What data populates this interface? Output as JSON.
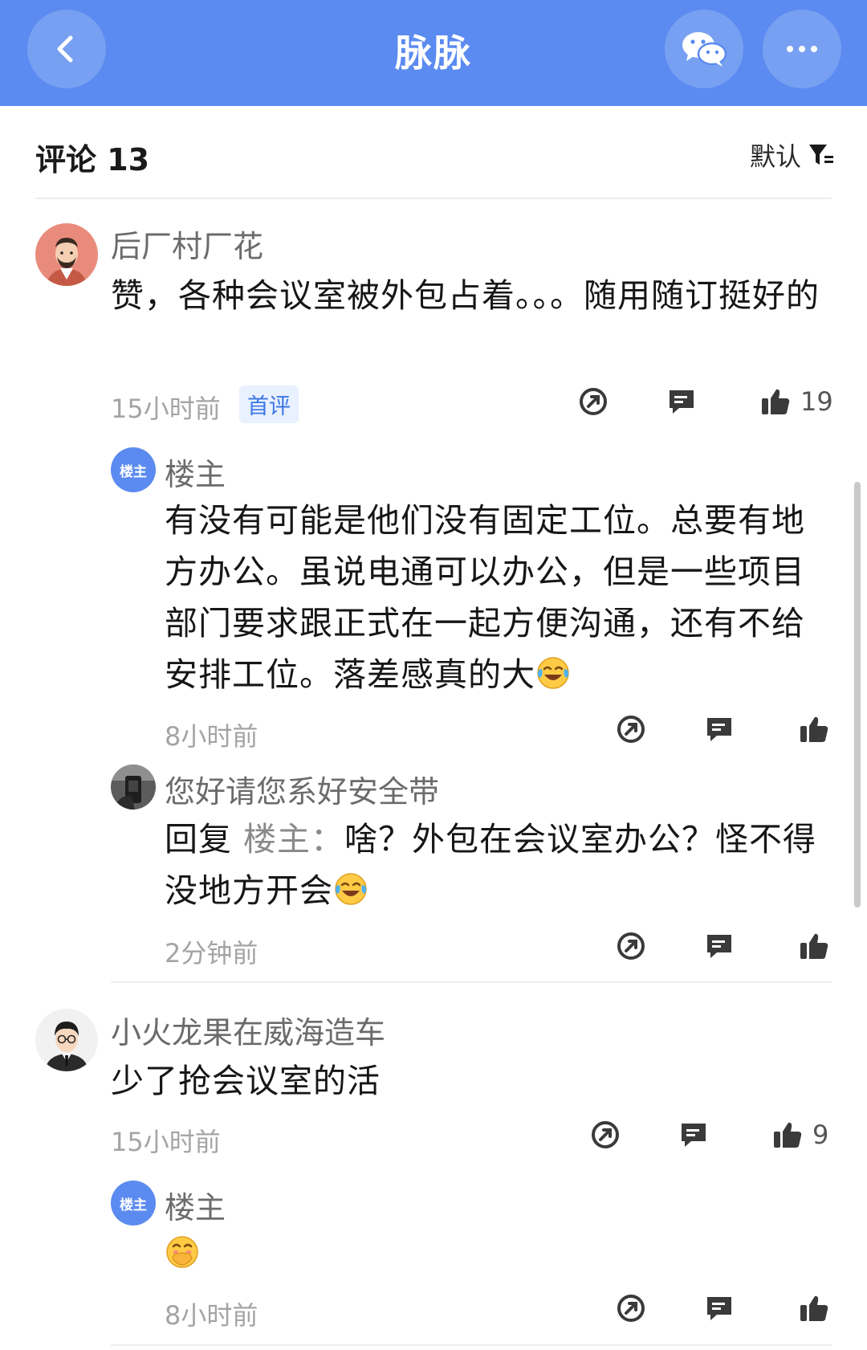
{
  "header": {
    "title": "脉脉"
  },
  "comments_header": {
    "label": "评论 13",
    "sort_label": "默认"
  },
  "threads": [
    {
      "user": "后厂村厂花",
      "text": "赞，各种会议室被外包占着。。。随用随订挺好的",
      "time": "15小时前",
      "tag": "首评",
      "likes": "19",
      "replies": [
        {
          "user": "楼主",
          "badge": "楼主",
          "text": "有没有可能是他们没有固定工位。总要有地方办公。虽说电通可以办公，但是一些项目部门要求跟正式在一起方便沟通，还有不给安排工位。落差感真的大",
          "time": "8小时前"
        },
        {
          "user": "您好请您系好安全带",
          "reply_prefix": "回复",
          "reply_target": "楼主：",
          "text": "啥？外包在会议室办公？怪不得没地方开会",
          "time": "2分钟前"
        }
      ]
    },
    {
      "user": "小火龙果在威海造车",
      "text": "少了抢会议室的活",
      "time": "15小时前",
      "likes": "9",
      "replies": [
        {
          "user": "楼主",
          "badge": "楼主",
          "time": "8小时前"
        }
      ]
    }
  ]
}
